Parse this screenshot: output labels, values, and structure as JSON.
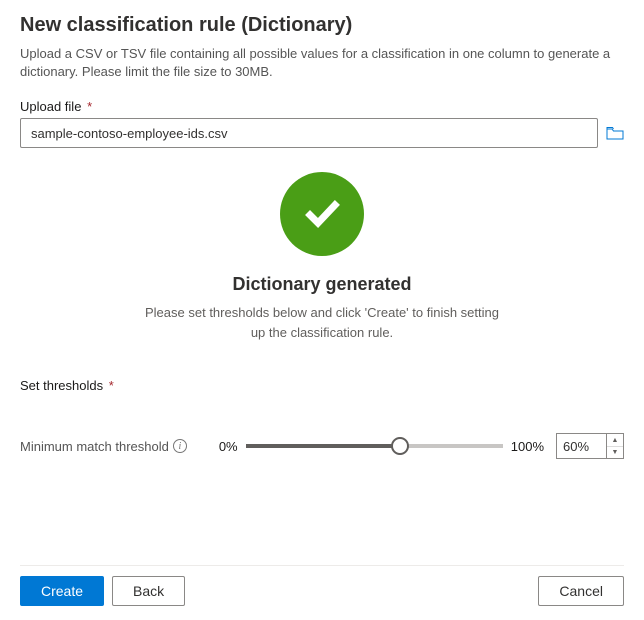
{
  "title": "New classification rule (Dictionary)",
  "description": "Upload a CSV or TSV file containing all possible values for a classification in one column to generate a dictionary. Please limit the file size to 30MB.",
  "upload": {
    "label": "Upload file",
    "required_mark": "*",
    "value": "sample-contoso-employee-ids.csv"
  },
  "status": {
    "title": "Dictionary generated",
    "message": "Please set thresholds below and click 'Create' to finish setting up the classification rule."
  },
  "thresholds": {
    "section_label": "Set thresholds",
    "required_mark": "*",
    "min_match_label": "Minimum match threshold",
    "range_min_label": "0%",
    "range_max_label": "100%",
    "value": "60%"
  },
  "footer": {
    "create": "Create",
    "back": "Back",
    "cancel": "Cancel"
  }
}
